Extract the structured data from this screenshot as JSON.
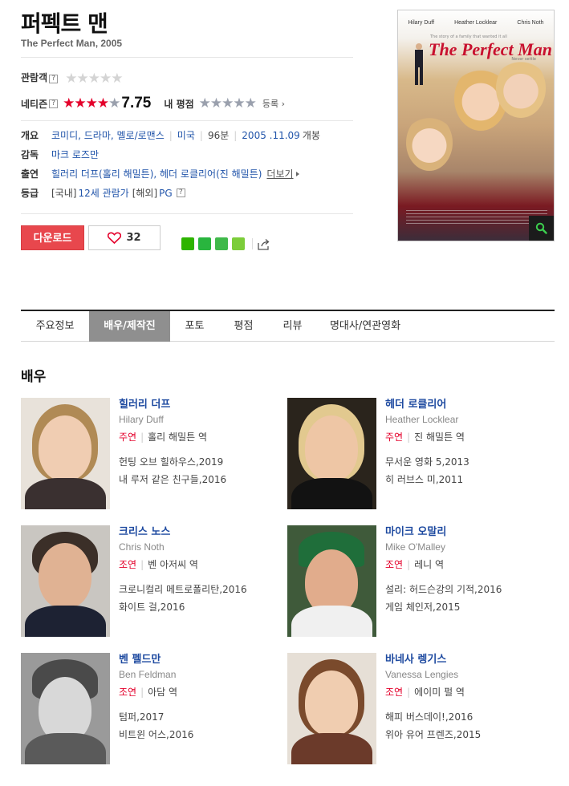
{
  "movie": {
    "title_ko": "퍼펙트 맨",
    "title_en": "The Perfect Man, 2005"
  },
  "ratings": {
    "audience_label": "관람객",
    "netizen_label": "네티즌",
    "help_glyph": "?",
    "star_glyph": "★",
    "netizen_stars": 4,
    "netizen_score": "7.75",
    "my_rating_label": "내 평점",
    "register_label": "등록",
    "register_arrow": "›"
  },
  "info": {
    "overview_label": "개요",
    "genres": "코미디, 드라마, 멜로/로맨스",
    "country": "미국",
    "runtime": "96분",
    "release_date": "2005 .11.09",
    "release_suffix": "개봉",
    "director_label": "감독",
    "director": "마크 로즈만",
    "cast_label": "출연",
    "cast": "힐러리 더프(홀리 해밀튼), 헤더 로클리어(진 해밀튼)",
    "more_label": "더보기",
    "grade_label": "등급",
    "grade_domestic_prefix": "[국내]",
    "grade_domestic": "12세 관람가",
    "grade_foreign_prefix": "[해외]",
    "grade_foreign": "PG"
  },
  "actions": {
    "download_label": "다운로드",
    "like_count": "32"
  },
  "poster": {
    "name1": "Hilary Duff",
    "name2": "Heather Locklear",
    "name3": "Chris Noth",
    "tagline": "The story of a family that wanted it all",
    "title": "The Perfect Man",
    "never": "Never settle"
  },
  "tabs": [
    {
      "label": "주요정보"
    },
    {
      "label": "배우/제작진"
    },
    {
      "label": "포토"
    },
    {
      "label": "평점"
    },
    {
      "label": "리뷰"
    },
    {
      "label": "명대사/연관영화"
    }
  ],
  "section_title": "배우",
  "actors": [
    {
      "name_ko": "힐러리 더프",
      "name_en": "Hilary Duff",
      "role_type": "주연",
      "role": "홀리 해밀튼 역",
      "works": [
        "헌팅 오브 힐하우스,2019",
        "내 루저 같은 친구들,2016"
      ]
    },
    {
      "name_ko": "헤더 로클리어",
      "name_en": "Heather Locklear",
      "role_type": "주연",
      "role": "진 해밀튼 역",
      "works": [
        "무서운 영화 5,2013",
        "히 러브스 미,2011"
      ]
    },
    {
      "name_ko": "크리스 노스",
      "name_en": "Chris Noth",
      "role_type": "조연",
      "role": "벤 아저씨 역",
      "works": [
        "크로니컬리 메트로폴리탄,2016",
        "화이트 걸,2016"
      ]
    },
    {
      "name_ko": "마이크 오말리",
      "name_en": "Mike O'Malley",
      "role_type": "조연",
      "role": "레니 역",
      "works": [
        "설리: 허드슨강의 기적,2016",
        "게임 체인저,2015"
      ]
    },
    {
      "name_ko": "벤 펠드만",
      "name_en": "Ben Feldman",
      "role_type": "조연",
      "role": "아담 역",
      "works": [
        "텀퍼,2017",
        "비트윈 어스,2016"
      ]
    },
    {
      "name_ko": "바네사 렝기스",
      "name_en": "Vanessa Lengies",
      "role_type": "조연",
      "role": "에이미 펄 역",
      "works": [
        "해피 버스데이!,2016",
        "위아 유어 프렌즈,2015"
      ]
    }
  ],
  "colors": {
    "accent_red": "#e4002b",
    "link_blue": "#1e4aa0",
    "download_bg": "#e8474d",
    "active_tab_bg": "#8f8f8f"
  }
}
